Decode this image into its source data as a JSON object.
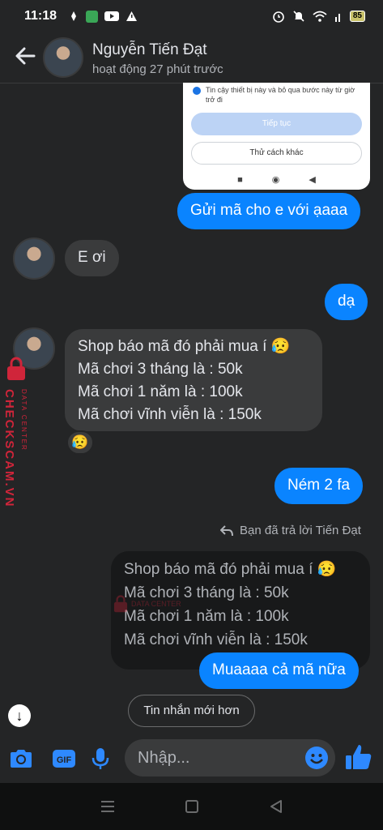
{
  "status_bar": {
    "time": "11:18",
    "battery": "85"
  },
  "header": {
    "name": "Nguyễn Tiến Đạt",
    "status": "hoạt động 27 phút trước"
  },
  "shared_screenshot": {
    "checkbox_text": "Tin cậy thiết bị này và bỏ qua bước này từ giờ trở đi",
    "continue_button": "Tiếp tục",
    "other_button": "Thử cách khác"
  },
  "messages": {
    "sent_1": "Gửi mã cho e với ạaaa",
    "received_1": "E ơi",
    "sent_2": "dạ",
    "received_2_lines": [
      "Shop báo mã đó phải mua í 😥",
      "Mã chơi 3 tháng là : 50k",
      "Mã chơi 1 năm là : 100k",
      "Mã chơi vĩnh viễn là : 150k"
    ],
    "reaction": "😥",
    "sent_3": "Ném 2 fa",
    "reply_label": "Bạn đã trả lời Tiến Đạt",
    "quoted_lines": [
      "Shop báo mã đó phải mua í 😥",
      "Mã chơi 3 tháng là : 50k",
      "Mã chơi 1 năm là : 100k",
      "Mã chơi vĩnh viễn là : 150k"
    ],
    "sent_4": "Muaaaa cả mã nữa"
  },
  "newer_messages_button": "Tin nhắn mới hơn",
  "composer": {
    "placeholder": "Nhập..."
  },
  "watermark": {
    "brand": "CHECKSCAM.VN",
    "sub": "DATA CENTER"
  },
  "colors": {
    "accent": "#0a84ff",
    "background": "#242526",
    "incoming": "#3a3b3c"
  },
  "icons": [
    "back-arrow-icon",
    "phone-icon",
    "video-icon",
    "settings-icon",
    "camera-icon",
    "gif-icon",
    "microphone-icon",
    "emoji-icon",
    "thumbs-up-icon",
    "reply-arrow-icon",
    "arrow-down-icon"
  ]
}
